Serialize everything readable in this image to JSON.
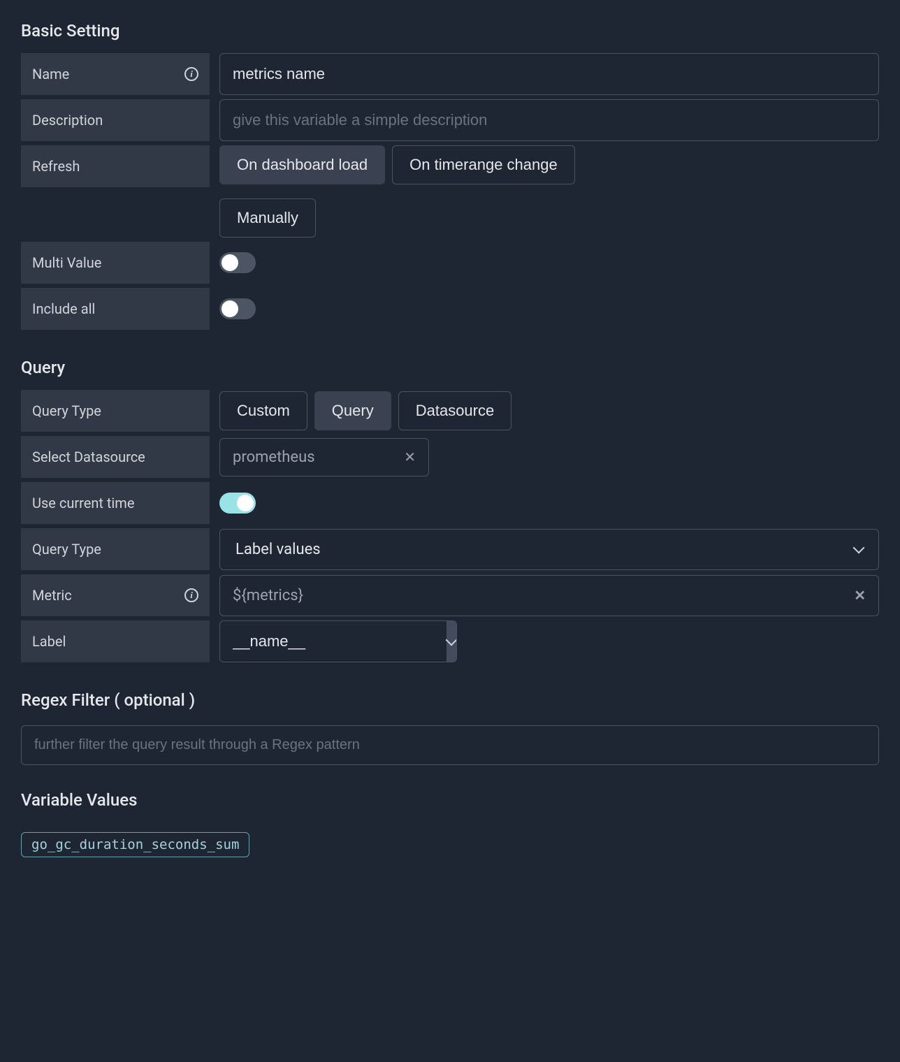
{
  "basic": {
    "title": "Basic Setting",
    "name_label": "Name",
    "name_value": "metrics name",
    "description_label": "Description",
    "description_placeholder": "give this variable a simple description",
    "refresh_label": "Refresh",
    "refresh_options": {
      "on_load": "On dashboard load",
      "on_timerange": "On timerange change",
      "manually": "Manually"
    },
    "refresh_selected": "on_load",
    "multi_value_label": "Multi Value",
    "multi_value": false,
    "include_all_label": "Include all",
    "include_all": false
  },
  "query": {
    "title": "Query",
    "query_type_label": "Query Type",
    "query_type_options": {
      "custom": "Custom",
      "query": "Query",
      "datasource": "Datasource"
    },
    "query_type_selected": "query",
    "select_ds_label": "Select Datasource",
    "select_ds_value": "prometheus",
    "use_current_time_label": "Use current time",
    "use_current_time": true,
    "query_type2_label": "Query Type",
    "query_type2_value": "Label values",
    "metric_label": "Metric",
    "metric_value": "${metrics}",
    "label_label": "Label",
    "label_value": "__name__"
  },
  "regex": {
    "title": "Regex Filter ( optional )",
    "placeholder": "further filter the query result through a Regex pattern"
  },
  "values": {
    "title": "Variable Values",
    "items": [
      "go_gc_duration_seconds_sum"
    ]
  }
}
